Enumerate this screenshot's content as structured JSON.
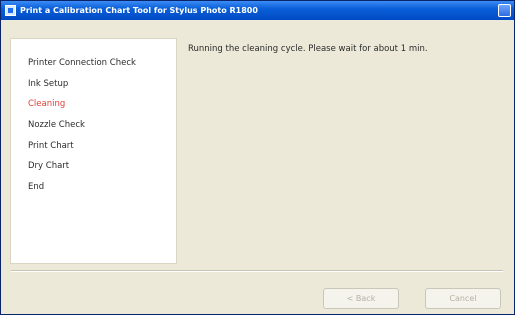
{
  "window": {
    "title": "Print a Calibration Chart Tool for Stylus Photo R1800"
  },
  "steps": [
    {
      "label": "Printer Connection Check",
      "active": false
    },
    {
      "label": "Ink Setup",
      "active": false
    },
    {
      "label": "Cleaning",
      "active": true
    },
    {
      "label": "Nozzle Check",
      "active": false
    },
    {
      "label": "Print Chart",
      "active": false
    },
    {
      "label": "Dry Chart",
      "active": false
    },
    {
      "label": "End",
      "active": false
    }
  ],
  "main": {
    "status_message": "Running the cleaning cycle. Please wait for about 1 min."
  },
  "footer": {
    "back_label": "< Back",
    "cancel_label": "Cancel"
  },
  "colors": {
    "active_step": "#e0403a",
    "titlebar": "#0a5fd8"
  }
}
